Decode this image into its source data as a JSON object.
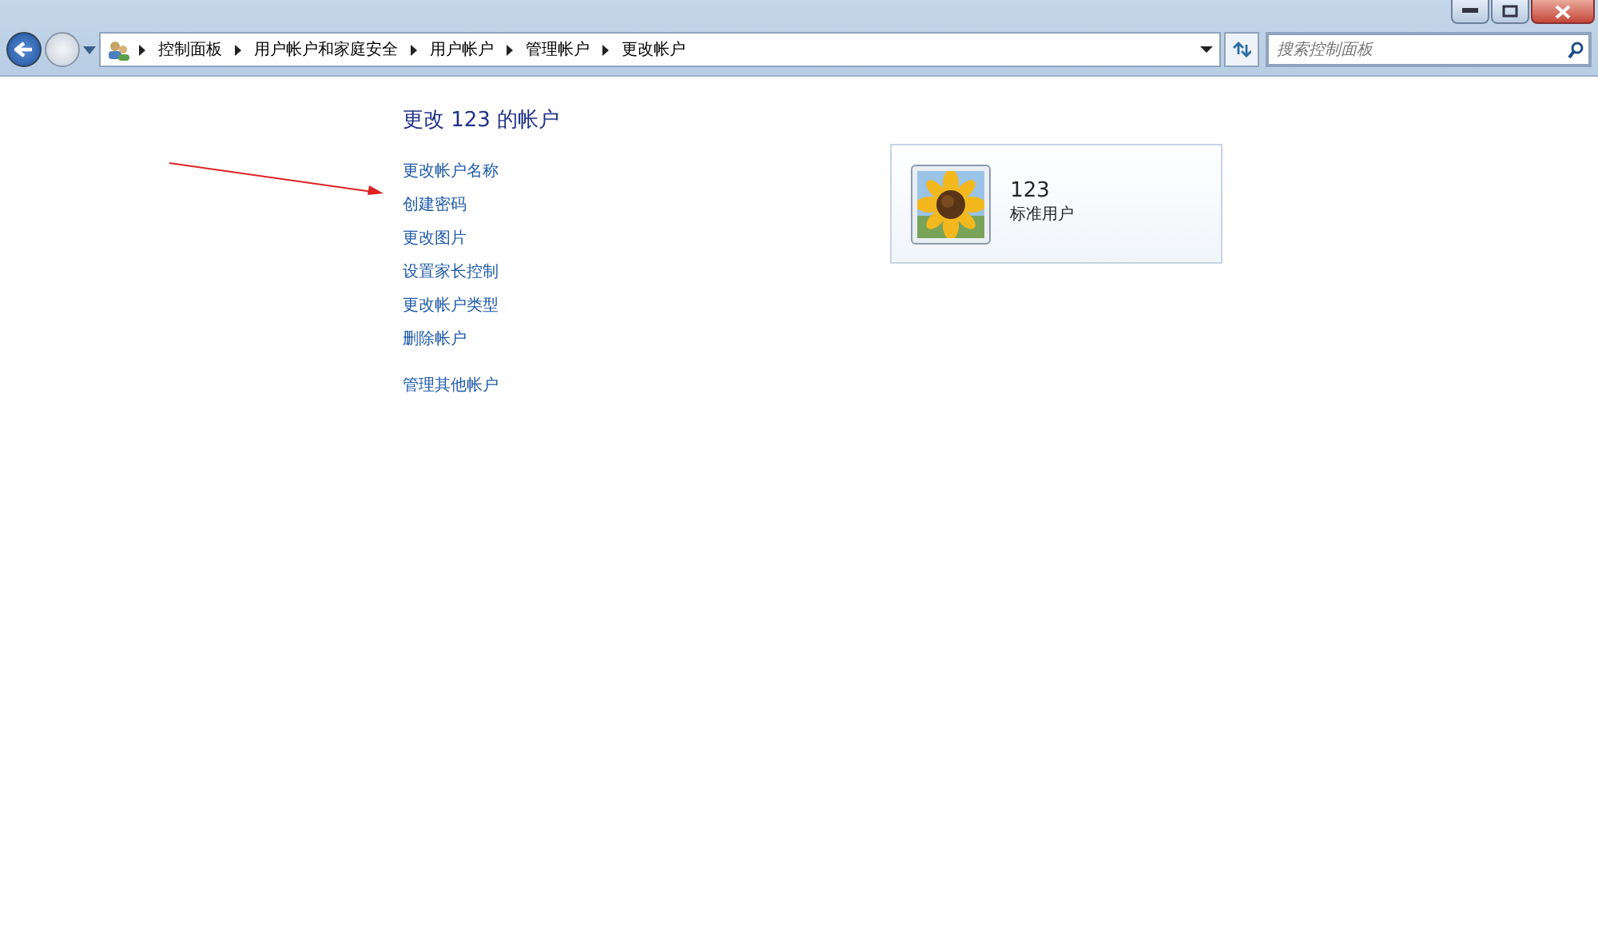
{
  "breadcrumb": [
    "控制面板",
    "用户帐户和家庭安全",
    "用户帐户",
    "管理帐户",
    "更改帐户"
  ],
  "search": {
    "placeholder": "搜索控制面板"
  },
  "page_title": "更改 123 的帐户",
  "tasks": [
    "更改帐户名称",
    "创建密码",
    "更改图片",
    "设置家长控制",
    "更改帐户类型",
    "删除帐户"
  ],
  "other_link": "管理其他帐户",
  "account": {
    "name": "123",
    "type": "标准用户"
  }
}
